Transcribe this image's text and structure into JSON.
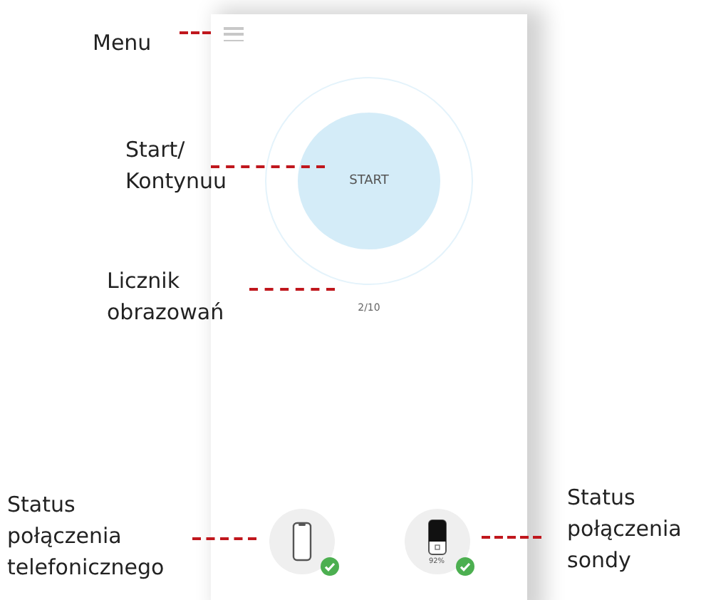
{
  "screen": {
    "start_button": {
      "label": "START"
    },
    "counter": "2/10",
    "phone_status": {
      "connected": true
    },
    "probe_status": {
      "battery": "92%",
      "connected": true
    }
  },
  "annotations": [
    {
      "lines": [
        "Menu"
      ]
    },
    {
      "lines": [
        "Start/",
        "Kontynuu"
      ]
    },
    {
      "lines": [
        "Licznik",
        "obrazowań"
      ]
    },
    {
      "lines": [
        "Status",
        "połączenia",
        "telefonicznego"
      ]
    },
    {
      "lines": [
        "Status",
        "połączenia",
        "sondy"
      ]
    }
  ]
}
